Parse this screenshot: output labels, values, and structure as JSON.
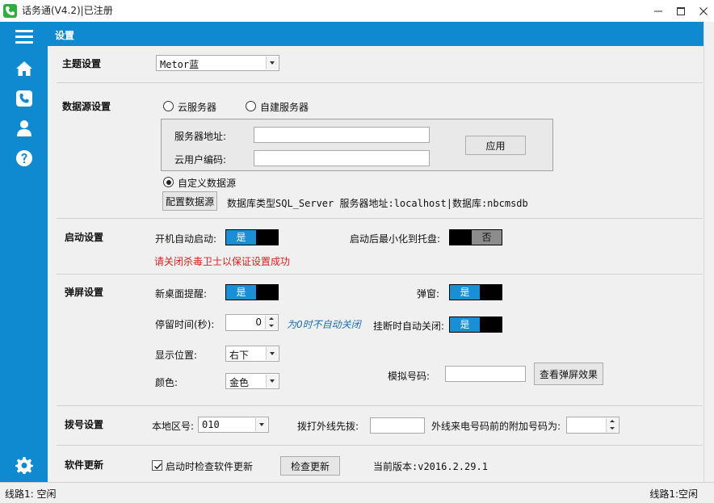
{
  "window": {
    "title": "话务通(V4.2)|已注册"
  },
  "header": {
    "title": "设置"
  },
  "theme": {
    "section": "主题设置",
    "value": "Metor蓝"
  },
  "datasource": {
    "section": "数据源设置",
    "cloud_label": "云服务器",
    "self_label": "自建服务器",
    "server_addr_label": "服务器地址:",
    "cloud_user_label": "云用户编码:",
    "apply_label": "应用",
    "custom_label": "自定义数据源",
    "config_label": "配置数据源",
    "info": "数据库类型SQL_Server 服务器地址:localhost|数据库:nbcmsdb"
  },
  "startup": {
    "section": "启动设置",
    "autostart_label": "开机自动启动:",
    "autostart_on": "是",
    "minimize_label": "启动后最小化到托盘:",
    "minimize_off": "否",
    "warning": "请关闭杀毒卫士以保证设置成功"
  },
  "popup": {
    "section": "弹屏设置",
    "desktop_label": "新桌面提醒:",
    "desktop_on": "是",
    "popwin_label": "弹窗:",
    "popwin_on": "是",
    "stay_label": "停留时间(秒):",
    "stay_value": "0",
    "stay_hint": "为0时不自动关闭",
    "hangup_label": "挂断时自动关闭:",
    "hangup_on": "是",
    "position_label": "显示位置:",
    "position_value": "右下",
    "color_label": "颜色:",
    "color_value": "金色",
    "sim_label": "模拟号码:",
    "view_label": "查看弹屏效果"
  },
  "dial": {
    "section": "拨号设置",
    "area_label": "本地区号:",
    "area_value": "010",
    "prefix_label": "拨打外线先拨:",
    "incoming_label": "外线来电号码前的附加号码为:"
  },
  "update": {
    "section": "软件更新",
    "check_label": "启动时检查软件更新",
    "check_btn": "检查更新",
    "version": "当前版本:v2016.2.29.1"
  },
  "status": {
    "left": "线路1: 空闲",
    "right": "线路1:空闲"
  }
}
